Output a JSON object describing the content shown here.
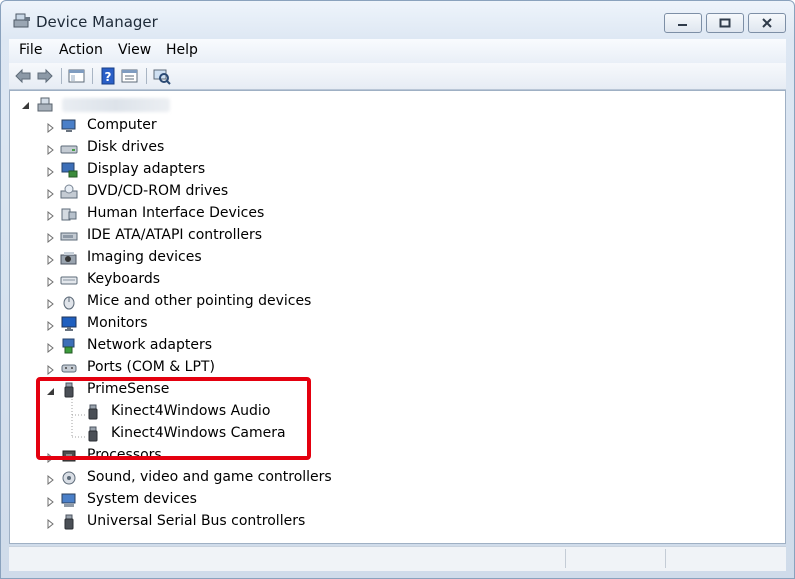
{
  "window": {
    "title": "Device Manager"
  },
  "menu": [
    "File",
    "Action",
    "View",
    "Help"
  ],
  "toolbar": {
    "buttons": [
      "back-arrow-icon",
      "forward-arrow-icon",
      "show-hide-console-tree-icon",
      "help-icon",
      "properties-icon",
      "scan-hardware-icon"
    ]
  },
  "tree": {
    "root": {
      "label": "",
      "icon": "computer-tower-icon",
      "expanded": true
    },
    "categories": [
      {
        "label": "Computer",
        "icon": "computer-icon"
      },
      {
        "label": "Disk drives",
        "icon": "disk-drive-icon"
      },
      {
        "label": "Display adapters",
        "icon": "display-adapter-icon"
      },
      {
        "label": "DVD/CD-ROM drives",
        "icon": "dvd-drive-icon"
      },
      {
        "label": "Human Interface Devices",
        "icon": "hid-icon"
      },
      {
        "label": "IDE ATA/ATAPI controllers",
        "icon": "ide-controller-icon"
      },
      {
        "label": "Imaging devices",
        "icon": "imaging-device-icon"
      },
      {
        "label": "Keyboards",
        "icon": "keyboard-icon"
      },
      {
        "label": "Mice and other pointing devices",
        "icon": "mouse-icon"
      },
      {
        "label": "Monitors",
        "icon": "monitor-icon"
      },
      {
        "label": "Network adapters",
        "icon": "network-adapter-icon"
      },
      {
        "label": "Ports (COM & LPT)",
        "icon": "port-icon"
      },
      {
        "label": "PrimeSense",
        "icon": "usb-plug-icon",
        "expanded": true,
        "children": [
          {
            "label": "Kinect4Windows Audio",
            "icon": "usb-plug-icon"
          },
          {
            "label": "Kinect4Windows Camera",
            "icon": "usb-plug-icon"
          }
        ]
      },
      {
        "label": "Processors",
        "icon": "processor-icon"
      },
      {
        "label": "Sound, video and game controllers",
        "icon": "sound-icon"
      },
      {
        "label": "System devices",
        "icon": "system-device-icon"
      },
      {
        "label": "Universal Serial Bus controllers",
        "icon": "usb-plug-icon"
      }
    ]
  },
  "annotation": {
    "color": "#e4000f"
  },
  "colors": {
    "window_border": "#8aa2bd",
    "tree_bg": "#ffffff"
  }
}
